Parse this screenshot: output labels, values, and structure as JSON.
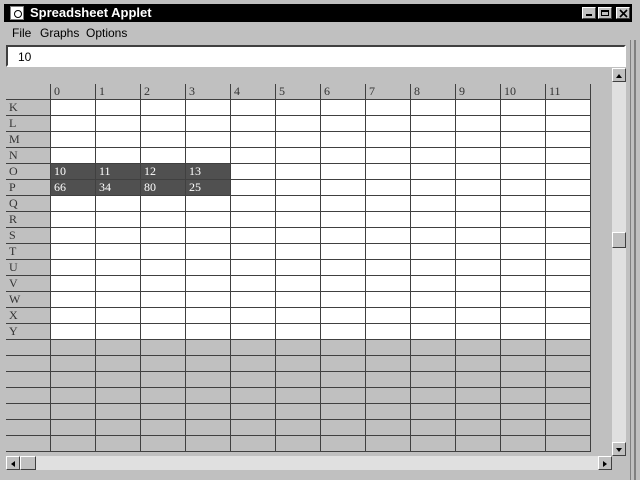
{
  "window": {
    "title": "Spreadsheet Applet"
  },
  "menubar": {
    "items": [
      "File",
      "Graphs",
      "Options"
    ]
  },
  "formula_bar": {
    "value": "10"
  },
  "sheet": {
    "column_headers": [
      "0",
      "1",
      "2",
      "3",
      "4",
      "5",
      "6",
      "7",
      "8",
      "9",
      "10",
      "11"
    ],
    "row_headers": [
      "K",
      "L",
      "M",
      "N",
      "O",
      "P",
      "Q",
      "R",
      "S",
      "T",
      "U",
      "V",
      "W",
      "X",
      "Y"
    ],
    "cells": {
      "O": [
        "10",
        "11",
        "12",
        "13"
      ],
      "P": [
        "66",
        "34",
        "80",
        "25"
      ]
    },
    "selected_rows": [
      "O",
      "P"
    ],
    "empty_rows_below": 7
  },
  "colors": {
    "selection": "#505050",
    "titlebar": "#000000",
    "chrome": "#c0c0c0"
  },
  "icons": {
    "app": "java-applet-icon",
    "minimize": "minimize-icon",
    "maximize": "maximize-icon",
    "close": "close-icon"
  }
}
